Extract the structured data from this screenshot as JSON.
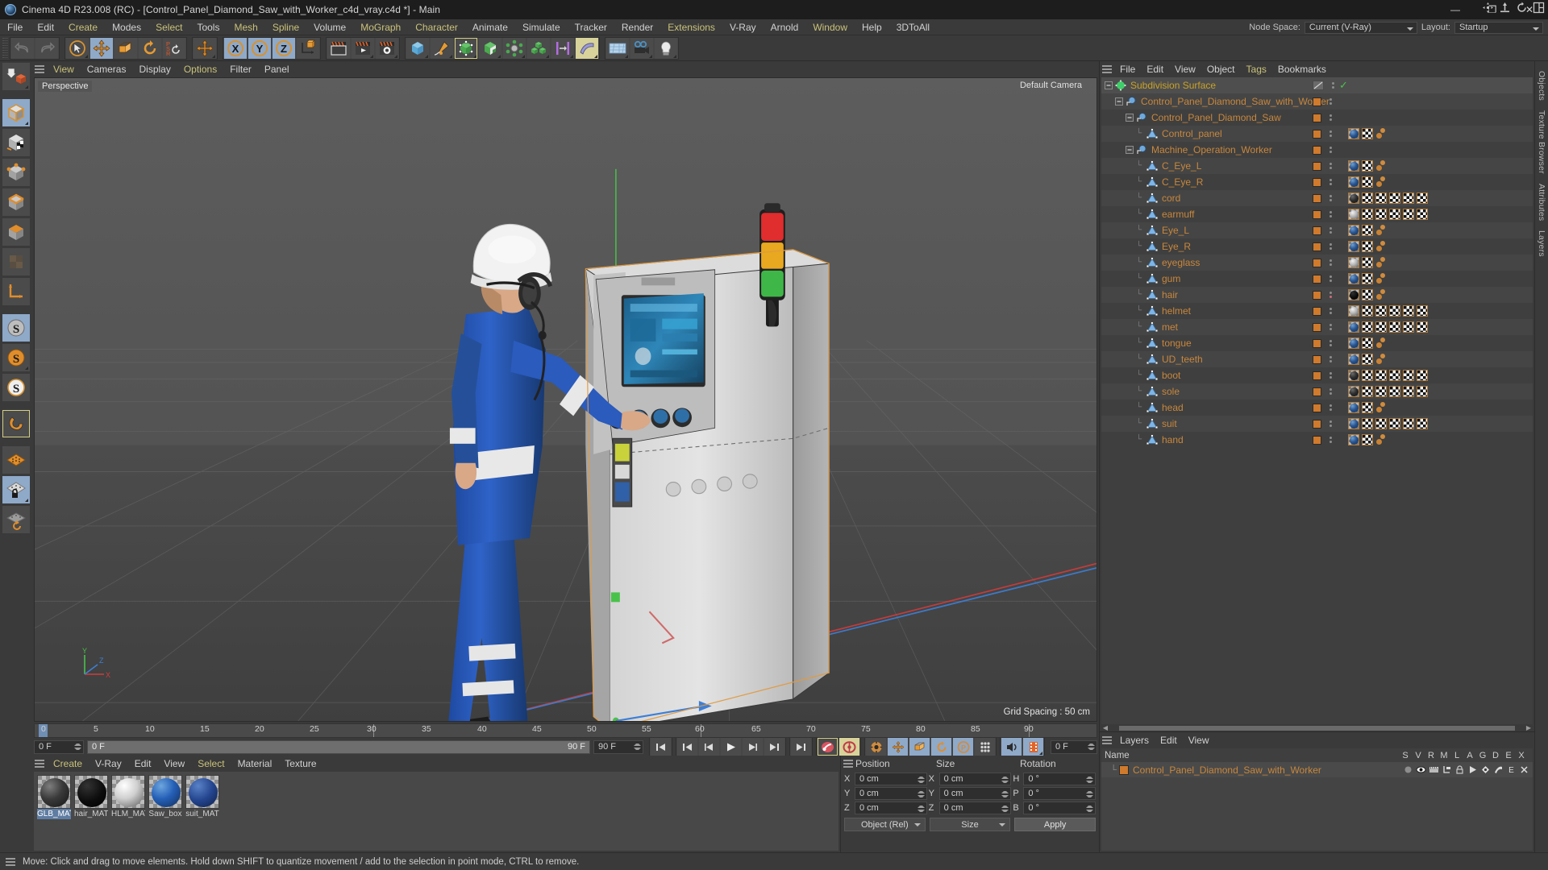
{
  "window": {
    "title": "Cinema 4D R23.008 (RC) - [Control_Panel_Diamond_Saw_with_Worker_c4d_vray.c4d *] - Main",
    "minimize": "—",
    "maximize": "❐",
    "close": "✕"
  },
  "menubar": {
    "items": [
      {
        "label": "File",
        "color": "white"
      },
      {
        "label": "Edit",
        "color": "white"
      },
      {
        "label": "Create",
        "color": "yellow"
      },
      {
        "label": "Modes",
        "color": "white"
      },
      {
        "label": "Select",
        "color": "yellow"
      },
      {
        "label": "Tools",
        "color": "white"
      },
      {
        "label": "Mesh",
        "color": "yellow"
      },
      {
        "label": "Spline",
        "color": "yellow"
      },
      {
        "label": "Volume",
        "color": "white"
      },
      {
        "label": "MoGraph",
        "color": "yellow"
      },
      {
        "label": "Character",
        "color": "yellow"
      },
      {
        "label": "Animate",
        "color": "white"
      },
      {
        "label": "Simulate",
        "color": "white"
      },
      {
        "label": "Tracker",
        "color": "white"
      },
      {
        "label": "Render",
        "color": "white"
      },
      {
        "label": "Extensions",
        "color": "yellow"
      },
      {
        "label": "V-Ray",
        "color": "white"
      },
      {
        "label": "Arnold",
        "color": "white"
      },
      {
        "label": "Window",
        "color": "yellow"
      },
      {
        "label": "Help",
        "color": "white"
      },
      {
        "label": "3DToAll",
        "color": "white"
      }
    ],
    "node_space_label": "Node Space:",
    "node_space_value": "Current (V-Ray)",
    "layout_label": "Layout:",
    "layout_value": "Startup"
  },
  "toolbar": {
    "undo": "undo-icon",
    "redo": "redo-icon",
    "live_selection": "live-selection-icon",
    "move": "move-tool-icon",
    "scale": "scale-tool-icon",
    "rotate": "rotate-tool-icon",
    "psr": "psr-icon",
    "world_axis": "world-axis-move-icon",
    "lock_x": "X",
    "lock_y": "Y",
    "lock_z": "Z",
    "coordinate_system": "coordinate-system-icon",
    "render_view": "render-view-icon",
    "render_picture_viewer": "render-picture-viewer-icon",
    "render_settings": "render-settings-icon",
    "cube_primitive": "cube-primitive-icon",
    "spline_pen": "spline-pen-icon",
    "subdivision_surface": "subdivision-surface-icon",
    "boole": "boole-icon",
    "array": "array-icon",
    "mograph_cloner": "mograph-cloner-icon",
    "bridge": "bridge-deformer-icon",
    "bend_deformer": "bend-deformer-icon",
    "floor": "floor-icon",
    "camera": "camera-icon",
    "light": "light-icon"
  },
  "leftbar": {
    "items": [
      {
        "name": "make-editable-icon"
      },
      {
        "name": "model-mode-icon",
        "state": "active"
      },
      {
        "name": "texture-mode-icon"
      },
      {
        "name": "point-mode-icon"
      },
      {
        "name": "edge-mode-icon"
      },
      {
        "name": "polygon-mode-icon"
      },
      {
        "name": "uv-mode-icon",
        "state": "disabled"
      },
      {
        "name": "axis-mode-icon"
      },
      {
        "name": "enable-axis-icon",
        "state": "active"
      },
      {
        "name": "object-axis-icon"
      },
      {
        "name": "viewport-solo-icon"
      },
      {
        "name": "snap-magnet-icon",
        "state": "outlined"
      },
      {
        "name": "workplane-icon"
      },
      {
        "name": "lock-workplane-icon",
        "state": "active"
      },
      {
        "name": "workplane-rotate-icon"
      }
    ]
  },
  "viewport": {
    "menu": [
      "View",
      "Cameras",
      "Display",
      "Options",
      "Filter",
      "Panel"
    ],
    "menu_colors": [
      "yellow",
      "white",
      "white",
      "yellow",
      "white",
      "white"
    ],
    "label": "Perspective",
    "camera": "Default Camera",
    "grid_spacing": "Grid Spacing : 50 cm",
    "axis_labels": {
      "x": "X",
      "y": "Y",
      "z": "Z"
    },
    "nav_icons": [
      "pan-icon",
      "dolly-icon",
      "orbit-icon",
      "maximize-view-icon"
    ]
  },
  "timeline": {
    "ticks": [
      {
        "label": "0",
        "value": 0
      },
      {
        "label": "5",
        "value": 5
      },
      {
        "label": "10",
        "value": 10
      },
      {
        "label": "15",
        "value": 15
      },
      {
        "label": "20",
        "value": 20
      },
      {
        "label": "25",
        "value": 25
      },
      {
        "label": "30",
        "value": 30
      },
      {
        "label": "35",
        "value": 35
      },
      {
        "label": "40",
        "value": 40
      },
      {
        "label": "45",
        "value": 45
      },
      {
        "label": "50",
        "value": 50
      },
      {
        "label": "55",
        "value": 55
      },
      {
        "label": "60",
        "value": 60
      },
      {
        "label": "65",
        "value": 65
      },
      {
        "label": "70",
        "value": 70
      },
      {
        "label": "75",
        "value": 75
      },
      {
        "label": "80",
        "value": 80
      },
      {
        "label": "85",
        "value": 85
      },
      {
        "label": "90",
        "value": 90
      }
    ],
    "range_start": 0,
    "range_end": 90,
    "current_frame_field": "0 F",
    "preview_min": "0 F",
    "preview_max": "90 F",
    "end_frame_field": "90 F",
    "current_frame_right": "0 F",
    "transport": {
      "goto_start": "goto-start-icon",
      "prev_key": "previous-keyframe-icon",
      "prev_frame": "previous-frame-icon",
      "play": "play-icon",
      "next_frame": "next-frame-icon",
      "next_key": "next-keyframe-icon",
      "goto_end": "goto-end-icon",
      "record": "record-active-object-icon",
      "autokey": "autokeying-icon",
      "keyframe_settings": "keyframe-selection-icon",
      "key_position": "key-position-icon",
      "key_scale": "key-scale-icon",
      "key_rotation": "key-rotation-icon",
      "key_param": "key-parameter-icon",
      "key_points": "key-point-level-icon",
      "sound": "sound-icon",
      "filmstrip": "filmstrip-icon"
    }
  },
  "materials": {
    "menu": [
      "Create",
      "V-Ray",
      "Edit",
      "View",
      "Select",
      "Material",
      "Texture"
    ],
    "menu_colors": [
      "yellow",
      "white",
      "white",
      "white",
      "yellow",
      "white",
      "white"
    ],
    "items": [
      {
        "name": "GLB_MAT",
        "color": "#2f2f33",
        "selected": true
      },
      {
        "name": "hair_MAT",
        "color": "#0a0a0a",
        "selected": false
      },
      {
        "name": "HLM_MAT",
        "color": "#d9d9d9",
        "selected": false
      },
      {
        "name": "Saw_box",
        "color": "#2c62b5",
        "selected": false
      },
      {
        "name": "suit_MAT",
        "color": "#2a4f9c",
        "selected": false
      }
    ]
  },
  "coordinates": {
    "headers": [
      "Position",
      "Size",
      "Rotation"
    ],
    "rows": [
      {
        "pos_label": "X",
        "pos_value": "0 cm",
        "size_label": "X",
        "size_value": "0 cm",
        "rot_label": "H",
        "rot_value": "0 °"
      },
      {
        "pos_label": "Y",
        "pos_value": "0 cm",
        "size_label": "Y",
        "size_value": "0 cm",
        "rot_label": "P",
        "rot_value": "0 °"
      },
      {
        "pos_label": "Z",
        "pos_value": "0 cm",
        "size_label": "Z",
        "size_value": "0 cm",
        "rot_label": "B",
        "rot_value": "0 °"
      }
    ],
    "mode_select": "Object (Rel)",
    "size_select": "Size",
    "apply_button": "Apply"
  },
  "object_manager": {
    "menu": [
      "File",
      "Edit",
      "View",
      "Object",
      "Tags",
      "Bookmarks"
    ],
    "menu_colors": [
      "white",
      "white",
      "white",
      "white",
      "yellow",
      "white"
    ],
    "items": [
      {
        "name": "Subdivision Surface",
        "depth": 0,
        "icon": "subdivision-surface-icon",
        "color": "yellow",
        "expander": true,
        "selected": true,
        "tags": [],
        "enable_check": true
      },
      {
        "name": "Control_Panel_Diamond_Saw_with_Worker",
        "depth": 1,
        "icon": "null-object-icon",
        "color": "orange",
        "expander": true,
        "tags": []
      },
      {
        "name": "Control_Panel_Diamond_Saw",
        "depth": 2,
        "icon": "null-object-icon",
        "color": "orange",
        "expander": true,
        "tags": []
      },
      {
        "name": "Control_panel",
        "depth": 3,
        "icon": "polygon-object-icon",
        "color": "orange",
        "expander": false,
        "tags": [
          "mat-blue",
          "uv",
          "sel"
        ]
      },
      {
        "name": "Machine_Operation_Worker",
        "depth": 2,
        "icon": "null-object-icon",
        "color": "orange",
        "expander": true,
        "tags": []
      },
      {
        "name": "C_Eye_L",
        "depth": 3,
        "icon": "polygon-object-icon",
        "color": "orange",
        "expander": false,
        "tags": [
          "mat-blue",
          "uv",
          "sel"
        ]
      },
      {
        "name": "C_Eye_R",
        "depth": 3,
        "icon": "polygon-object-icon",
        "color": "orange",
        "expander": false,
        "tags": [
          "mat-blue",
          "uv",
          "sel"
        ]
      },
      {
        "name": "cord",
        "depth": 3,
        "icon": "polygon-object-icon",
        "color": "orange",
        "expander": false,
        "tags": [
          "mat-dark",
          "uv",
          "uv",
          "uv",
          "uv",
          "uv"
        ]
      },
      {
        "name": "earmuff",
        "depth": 3,
        "icon": "polygon-object-icon",
        "color": "orange",
        "expander": false,
        "tags": [
          "mat-grey",
          "uv",
          "uv",
          "uv",
          "uv",
          "uv"
        ]
      },
      {
        "name": "Eye_L",
        "depth": 3,
        "icon": "polygon-object-icon",
        "color": "orange",
        "expander": false,
        "tags": [
          "mat-blue",
          "uv",
          "sel"
        ]
      },
      {
        "name": "Eye_R",
        "depth": 3,
        "icon": "polygon-object-icon",
        "color": "orange",
        "expander": false,
        "tags": [
          "mat-blue",
          "uv",
          "sel"
        ]
      },
      {
        "name": "eyeglass",
        "depth": 3,
        "icon": "polygon-object-icon",
        "color": "orange",
        "expander": false,
        "tags": [
          "mat-grey",
          "uv",
          "sel"
        ]
      },
      {
        "name": "gum",
        "depth": 3,
        "icon": "polygon-object-icon",
        "color": "orange",
        "expander": false,
        "tags": [
          "mat-blue",
          "uv",
          "sel"
        ]
      },
      {
        "name": "hair",
        "depth": 3,
        "icon": "polygon-object-icon",
        "color": "orange",
        "expander": false,
        "tags": [
          "mat-black",
          "uv",
          "sel"
        ],
        "dot_red": true
      },
      {
        "name": "helmet",
        "depth": 3,
        "icon": "polygon-object-icon",
        "color": "orange",
        "expander": false,
        "tags": [
          "mat-grey",
          "uv",
          "uv",
          "uv",
          "uv",
          "uv"
        ]
      },
      {
        "name": "met",
        "depth": 3,
        "icon": "polygon-object-icon",
        "color": "orange",
        "expander": false,
        "tags": [
          "mat-blue",
          "uv",
          "uv",
          "uv",
          "uv",
          "uv"
        ]
      },
      {
        "name": "tongue",
        "depth": 3,
        "icon": "polygon-object-icon",
        "color": "orange",
        "expander": false,
        "tags": [
          "mat-blue",
          "uv",
          "sel"
        ]
      },
      {
        "name": "UD_teeth",
        "depth": 3,
        "icon": "polygon-object-icon",
        "color": "orange",
        "expander": false,
        "tags": [
          "mat-blue",
          "uv",
          "sel"
        ]
      },
      {
        "name": "boot",
        "depth": 3,
        "icon": "polygon-object-icon",
        "color": "orange",
        "expander": false,
        "tags": [
          "mat-dark",
          "uv",
          "uv",
          "uv",
          "uv",
          "uv"
        ]
      },
      {
        "name": "sole",
        "depth": 3,
        "icon": "polygon-object-icon",
        "color": "orange",
        "expander": false,
        "tags": [
          "mat-dark",
          "uv",
          "uv",
          "uv",
          "uv",
          "uv"
        ]
      },
      {
        "name": "head",
        "depth": 3,
        "icon": "polygon-object-icon",
        "color": "orange",
        "expander": false,
        "tags": [
          "mat-blue",
          "uv",
          "sel"
        ]
      },
      {
        "name": "suit",
        "depth": 3,
        "icon": "polygon-object-icon",
        "color": "orange",
        "expander": false,
        "tags": [
          "mat-blue",
          "uv",
          "uv",
          "uv",
          "uv",
          "uv"
        ]
      },
      {
        "name": "hand",
        "depth": 3,
        "icon": "polygon-object-icon",
        "color": "orange",
        "expander": false,
        "tags": [
          "mat-blue",
          "uv",
          "sel"
        ]
      }
    ]
  },
  "layer_manager": {
    "menu": [
      "Layers",
      "Edit",
      "View"
    ],
    "name_header": "Name",
    "columns": [
      "S",
      "V",
      "R",
      "M",
      "L",
      "A",
      "G",
      "D",
      "E",
      "X"
    ],
    "rows": [
      {
        "name": "Control_Panel_Diamond_Saw_with_Worker",
        "color": "#cf7a2c"
      }
    ]
  },
  "right_edge_tabs": [
    "Objects",
    "Texture Browser",
    "Attributes",
    "Layers"
  ],
  "statusbar": {
    "message": "Move: Click and drag to move elements. Hold down SHIFT to quantize movement / add to the selection in point mode, CTRL to remove."
  },
  "colors": {
    "accent_orange": "#cf7a2c",
    "object_text": "#c8873c",
    "menu_yellow": "#c9c27a",
    "panel_bg": "#3a3a3a",
    "active_blue": "#8fa9c9",
    "active_yellow": "#d8d39a"
  }
}
